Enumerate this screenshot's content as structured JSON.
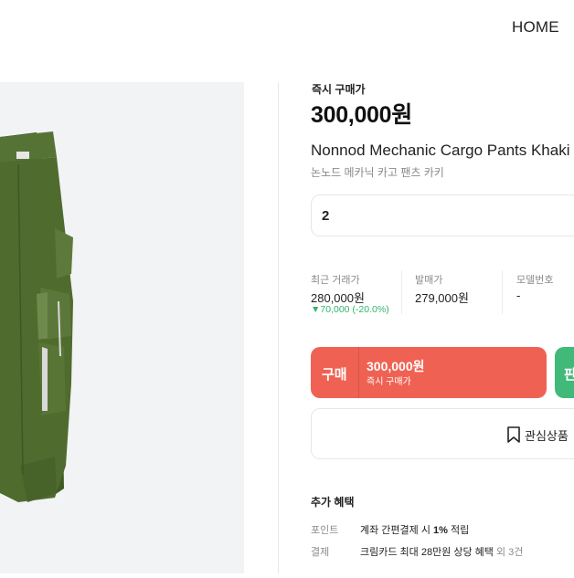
{
  "header": {
    "home_label": "HOME"
  },
  "product": {
    "instant_label": "즉시 구매가",
    "instant_price": "300,000원",
    "name_en": "Nonnod Mechanic Cargo Pants Khaki",
    "name_ko": "논노드 메카닉 카고 팬츠 카키",
    "size_value": "2"
  },
  "stats": {
    "recent": {
      "label": "최근 거래가",
      "value": "280,000원",
      "change": "▼70,000 (-20.0%)"
    },
    "release": {
      "label": "발매가",
      "value": "279,000원"
    },
    "model": {
      "label": "모델번호",
      "value": "-"
    }
  },
  "actions": {
    "buy_label": "구매",
    "buy_price": "300,000원",
    "buy_sub": "즉시 구매가",
    "sell_label": "판",
    "wish_label": "관심상품"
  },
  "benefits": {
    "title": "추가 혜택",
    "point_key": "포인트",
    "point_val_prefix": "계좌 간편결제 시 ",
    "point_val_bold": "1%",
    "point_val_suffix": " 적립",
    "pay_key": "결제",
    "pay_val": "크림카드 최대 28만원 상당 혜택",
    "pay_more": " 외 3건"
  },
  "colors": {
    "buy": "#ef6253",
    "sell": "#41b979",
    "drop": "#31b46e",
    "pants": "#4f6b2e"
  }
}
